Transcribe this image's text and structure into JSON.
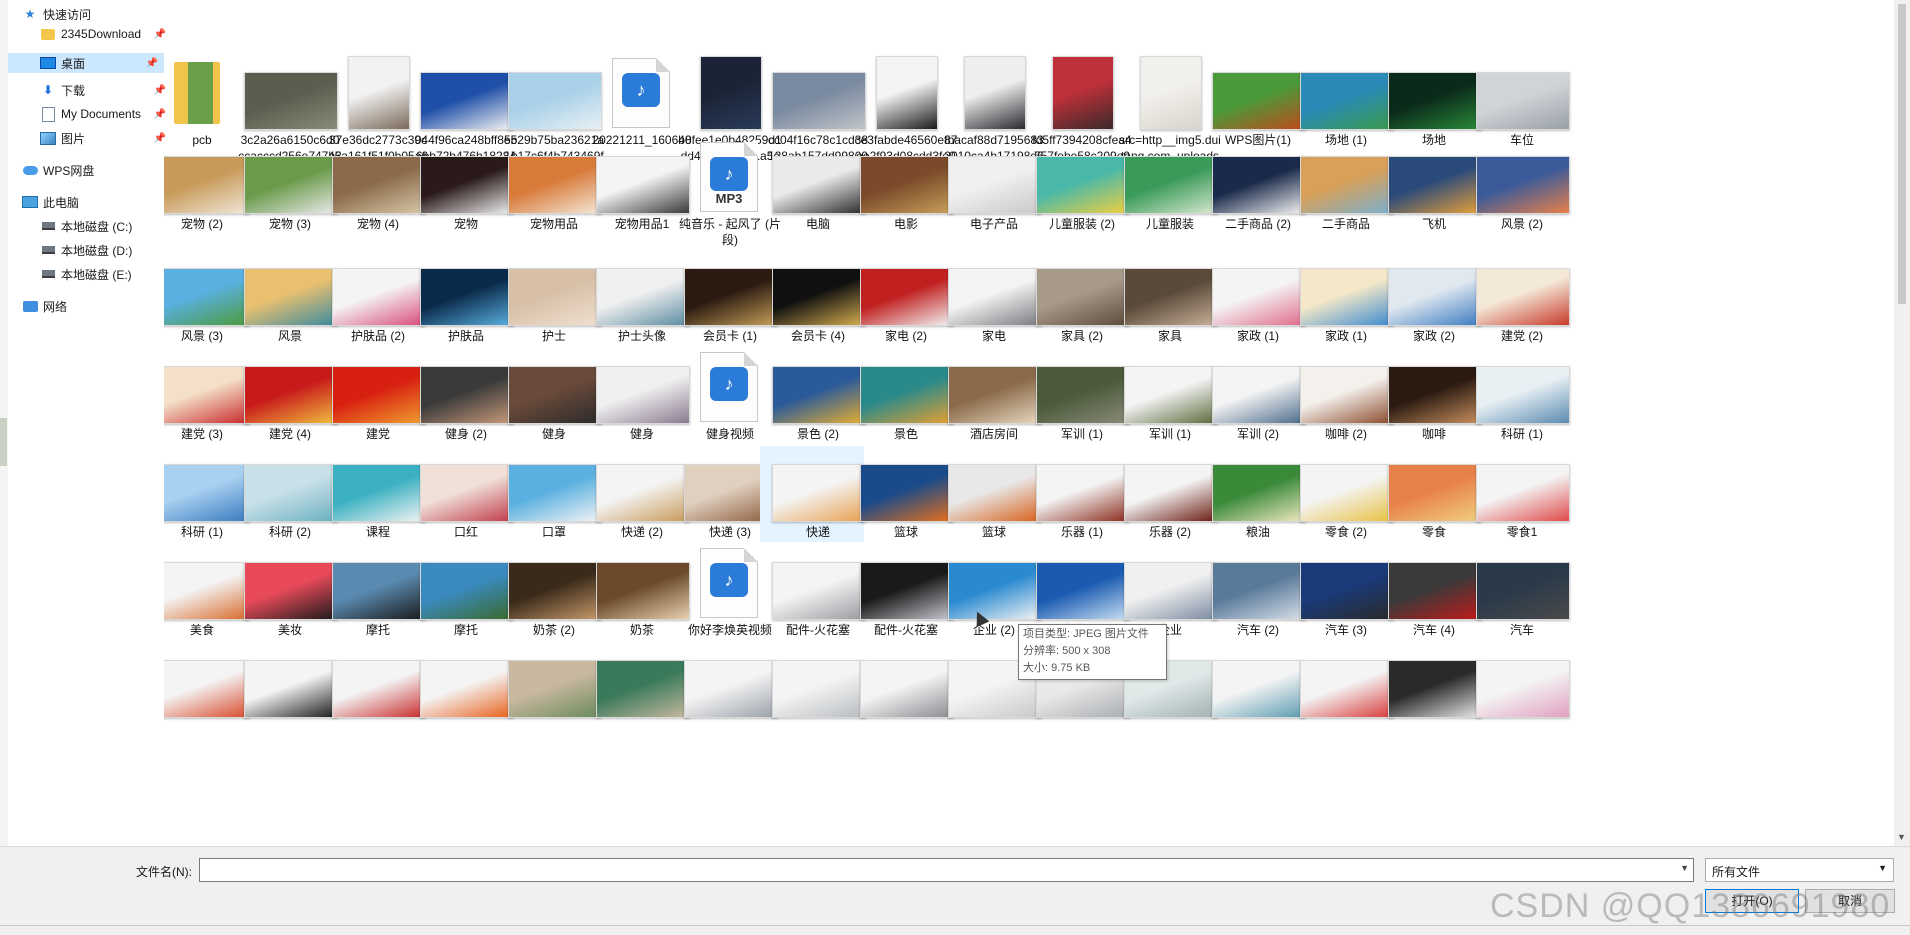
{
  "sidebar": {
    "items": [
      {
        "label": "快速访问",
        "icon": "star-icon"
      },
      {
        "label": "2345Download",
        "icon": "folder-icon",
        "pinned": true
      },
      {
        "label": "桌面",
        "icon": "desktop-icon",
        "pinned": true,
        "selected": true
      },
      {
        "label": "下载",
        "icon": "download-icon",
        "pinned": true
      },
      {
        "label": "My Documents",
        "icon": "document-icon",
        "pinned": true
      },
      {
        "label": "图片",
        "icon": "pictures-icon",
        "pinned": true
      },
      {
        "label": "WPS网盘",
        "icon": "cloud-icon"
      },
      {
        "label": "此电脑",
        "icon": "computer-icon"
      },
      {
        "label": "本地磁盘 (C:)",
        "icon": "drive-icon"
      },
      {
        "label": "本地磁盘 (D:)",
        "icon": "drive-icon"
      },
      {
        "label": "本地磁盘 (E:)",
        "icon": "drive-icon"
      },
      {
        "label": "网络",
        "icon": "network-icon"
      }
    ],
    "pin_glyph": "📌"
  },
  "files": [
    {
      "name": "pcb",
      "kind": "folder",
      "colors": [
        "#f0c44c",
        "#6aa04a"
      ]
    },
    {
      "name": "3c2a26a6150c6d0ccacccd256e747b3c",
      "kind": "image",
      "colors": [
        "#5a5e4e",
        "#8a8a78"
      ]
    },
    {
      "name": "37e36dc2773c39c45a161f51f0b05a6c",
      "kind": "image",
      "colors": [
        "#f2f2f2",
        "#7b6a5a"
      ]
    },
    {
      "name": "044f96ca248bff8eb6bb72b476b18284 (1)(1)",
      "kind": "image",
      "colors": [
        "#1f4fa8",
        "#f4f4f4"
      ]
    },
    {
      "name": "5529b75ba23621a1b17c6f4b743469f5",
      "kind": "image",
      "colors": [
        "#a8d0e8",
        "#e8f0f4"
      ]
    },
    {
      "name": "20221211_160640",
      "kind": "video"
    },
    {
      "name": "b8fee1e0b48259d1dd49a549c361a5c2",
      "kind": "image",
      "colors": [
        "#1a2436",
        "#2a3a5a"
      ]
    },
    {
      "name": "cc04f16c78c1cd38128ab157dd998093",
      "kind": "image",
      "colors": [
        "#7a8aa0",
        "#c0c4c8"
      ]
    },
    {
      "name": "ce3fabde46560e87ee2f93d08cdd3fe0(1)",
      "kind": "image",
      "colors": [
        "#f4f4f4",
        "#1a1a1a"
      ]
    },
    {
      "name": "fbacaf88d71956832010ca4b17198d62(1)",
      "kind": "image",
      "colors": [
        "#eeeeee",
        "#2a2a30"
      ]
    },
    {
      "name": "fd5ff7394208cfea4757febe58c209e9",
      "kind": "image",
      "colors": [
        "#c0303a",
        "#3a2a2a"
      ]
    },
    {
      "name": "src=http__img5.duitang.com_uploads_item_201507_14_201...",
      "kind": "image",
      "colors": [
        "#f2f0ec",
        "#d8d4cc"
      ]
    },
    {
      "name": "WPS图片(1)",
      "kind": "image",
      "colors": [
        "#4a9a3a",
        "#c04a1a"
      ]
    },
    {
      "name": "场地 (1)",
      "kind": "image",
      "colors": [
        "#2a8ab8",
        "#3a9a4a"
      ]
    },
    {
      "name": "场地",
      "kind": "image",
      "colors": [
        "#0a2a1a",
        "#2a8a3a"
      ]
    },
    {
      "name": "车位",
      "kind": "image",
      "colors": [
        "#d0d4d8",
        "#9aa0a8"
      ]
    },
    {
      "name": "宠物 (2)",
      "kind": "image",
      "colors": [
        "#c89a5a",
        "#f0e8d8"
      ]
    },
    {
      "name": "宠物 (3)",
      "kind": "image",
      "colors": [
        "#6a9a4a",
        "#eaeaea"
      ]
    },
    {
      "name": "宠物 (4)",
      "kind": "image",
      "colors": [
        "#8a6a4a",
        "#d8c8a8"
      ]
    },
    {
      "name": "宠物",
      "kind": "image",
      "colors": [
        "#2a1a1a",
        "#f0f0f0"
      ]
    },
    {
      "name": "宠物用品",
      "kind": "image",
      "colors": [
        "#d87a3a",
        "#f4e8d8"
      ]
    },
    {
      "name": "宠物用品1",
      "kind": "image",
      "colors": [
        "#f4f4f4",
        "#3a3a3a"
      ]
    },
    {
      "name": "纯音乐 - 起风了 (片段)",
      "kind": "audio",
      "badge": "MP3"
    },
    {
      "name": "电脑",
      "kind": "image",
      "colors": [
        "#eaeaea",
        "#2a2a2a"
      ]
    },
    {
      "name": "电影",
      "kind": "image",
      "colors": [
        "#7a4a2a",
        "#c8a05a"
      ]
    },
    {
      "name": "电子产品",
      "kind": "image",
      "colors": [
        "#f0f0f0",
        "#c8c8c8"
      ]
    },
    {
      "name": "儿童服装 (2)",
      "kind": "image",
      "colors": [
        "#4ab8a8",
        "#f0d040"
      ]
    },
    {
      "name": "儿童服装",
      "kind": "image",
      "colors": [
        "#3a9a5a",
        "#d8e8d0"
      ]
    },
    {
      "name": "二手商品 (2)",
      "kind": "image",
      "colors": [
        "#1a2a4a",
        "#f4f4f4"
      ]
    },
    {
      "name": "二手商品",
      "kind": "image",
      "colors": [
        "#d8a058",
        "#7ab0d0"
      ]
    },
    {
      "name": "飞机",
      "kind": "image",
      "colors": [
        "#2a4a7a",
        "#e8a03a"
      ]
    },
    {
      "name": "风景 (2)",
      "kind": "image",
      "colors": [
        "#3a5a9a",
        "#e8804a"
      ]
    },
    {
      "name": "风景 (3)",
      "kind": "image",
      "colors": [
        "#5ab0e0",
        "#4a9a3a"
      ]
    },
    {
      "name": "风景",
      "kind": "image",
      "colors": [
        "#e8c070",
        "#3a8aa0"
      ]
    },
    {
      "name": "护肤品 (2)",
      "kind": "image",
      "colors": [
        "#f4f4f4",
        "#d84a7a"
      ]
    },
    {
      "name": "护肤品",
      "kind": "image",
      "colors": [
        "#0a2a4a",
        "#5ab0e0"
      ]
    },
    {
      "name": "护士",
      "kind": "image",
      "colors": [
        "#d8c0a8",
        "#f0e0d0"
      ]
    },
    {
      "name": "护士头像",
      "kind": "image",
      "colors": [
        "#f0f0f0",
        "#5a8aa0"
      ]
    },
    {
      "name": "会员卡 (1)",
      "kind": "image",
      "colors": [
        "#2a1a10",
        "#c8a05a"
      ]
    },
    {
      "name": "会员卡 (4)",
      "kind": "image",
      "colors": [
        "#101010",
        "#d8b050"
      ]
    },
    {
      "name": "家电 (2)",
      "kind": "image",
      "colors": [
        "#c02020",
        "#f4f4f4"
      ]
    },
    {
      "name": "家电",
      "kind": "image",
      "colors": [
        "#f4f4f4",
        "#7a7a80"
      ]
    },
    {
      "name": "家具 (2)",
      "kind": "image",
      "colors": [
        "#a89a88",
        "#5a4a3a"
      ]
    },
    {
      "name": "家具",
      "kind": "image",
      "colors": [
        "#5a4a3a",
        "#c8b098"
      ]
    },
    {
      "name": "家政 (1)",
      "kind": "image",
      "colors": [
        "#f4f4f4",
        "#e06a8a"
      ]
    },
    {
      "name": "家政 (1)",
      "kind": "image",
      "colors": [
        "#f4e8c8",
        "#3a8ad0"
      ]
    },
    {
      "name": "家政 (2)",
      "kind": "image",
      "colors": [
        "#e0e8f0",
        "#3a7ac0"
      ]
    },
    {
      "name": "建党 (2)",
      "kind": "image",
      "colors": [
        "#f4e8d8",
        "#c83a2a"
      ]
    },
    {
      "name": "建党 (3)",
      "kind": "image",
      "colors": [
        "#f4e0c8",
        "#c8282a"
      ]
    },
    {
      "name": "建党 (4)",
      "kind": "image",
      "colors": [
        "#c81a1a",
        "#f0c040"
      ]
    },
    {
      "name": "建党",
      "kind": "image",
      "colors": [
        "#d82010",
        "#f0a030"
      ]
    },
    {
      "name": "健身 (2)",
      "kind": "image",
      "colors": [
        "#3a3a3a",
        "#c89a7a"
      ]
    },
    {
      "name": "健身",
      "kind": "image",
      "colors": [
        "#6a4a3a",
        "#2a2a2a"
      ]
    },
    {
      "name": "健身",
      "kind": "image",
      "colors": [
        "#f0f0f0",
        "#8a7a90"
      ]
    },
    {
      "name": "健身视频",
      "kind": "video"
    },
    {
      "name": "景色 (2)",
      "kind": "image",
      "colors": [
        "#2a5a9a",
        "#e8b030"
      ]
    },
    {
      "name": "景色",
      "kind": "image",
      "colors": [
        "#2a8a8a",
        "#e8a030"
      ]
    },
    {
      "name": "酒店房间",
      "kind": "image",
      "colors": [
        "#8a6a4a",
        "#e8d8c0"
      ]
    },
    {
      "name": "军训 (1)",
      "kind": "image",
      "colors": [
        "#4a5a3a",
        "#8a8a7a"
      ]
    },
    {
      "name": "军训 (1)",
      "kind": "image",
      "colors": [
        "#f4f4f4",
        "#5a6a3a"
      ]
    },
    {
      "name": "军训 (2)",
      "kind": "image",
      "colors": [
        "#f4f4f4",
        "#4a6a8a"
      ]
    },
    {
      "name": "咖啡 (2)",
      "kind": "image",
      "colors": [
        "#f4f0ec",
        "#8a4a2a"
      ]
    },
    {
      "name": "咖啡",
      "kind": "image",
      "colors": [
        "#2a1a10",
        "#c89060"
      ]
    },
    {
      "name": "科研 (1)",
      "kind": "image",
      "colors": [
        "#e8f0f4",
        "#5a8ab0"
      ]
    },
    {
      "name": "科研 (1)",
      "kind": "image",
      "colors": [
        "#a8d0f0",
        "#3a7ac0"
      ]
    },
    {
      "name": "科研 (2)",
      "kind": "image",
      "colors": [
        "#c8e0e8",
        "#6ab0c0"
      ]
    },
    {
      "name": "课程",
      "kind": "image",
      "colors": [
        "#3ab0c0",
        "#f4f4f4"
      ]
    },
    {
      "name": "口红",
      "kind": "image",
      "colors": [
        "#f0e0d8",
        "#c03a4a"
      ]
    },
    {
      "name": "口罩",
      "kind": "image",
      "colors": [
        "#5ab0e0",
        "#f4f4f4"
      ]
    },
    {
      "name": "快递 (2)",
      "kind": "image",
      "colors": [
        "#f4f4f4",
        "#c89a5a"
      ]
    },
    {
      "name": "快递 (3)",
      "kind": "image",
      "colors": [
        "#e0d0c0",
        "#8a5a3a"
      ]
    },
    {
      "name": "快递",
      "kind": "image",
      "colors": [
        "#f4f4f4",
        "#e8a050"
      ],
      "hover": true
    },
    {
      "name": "篮球",
      "kind": "image",
      "colors": [
        "#1a4a8a",
        "#e8701a"
      ]
    },
    {
      "name": "篮球",
      "kind": "image",
      "colors": [
        "#e8e8e8",
        "#d8601a"
      ]
    },
    {
      "name": "乐器 (1)",
      "kind": "image",
      "colors": [
        "#f4f4f4",
        "#8a2a1a"
      ]
    },
    {
      "name": "乐器 (2)",
      "kind": "image",
      "colors": [
        "#f4f4f4",
        "#6a1a10"
      ]
    },
    {
      "name": "粮油",
      "kind": "image",
      "colors": [
        "#3a8a3a",
        "#f0e8c0"
      ]
    },
    {
      "name": "零食 (2)",
      "kind": "image",
      "colors": [
        "#f4f4f4",
        "#e8c040"
      ]
    },
    {
      "name": "零食",
      "kind": "image",
      "colors": [
        "#e8804a",
        "#f0d080"
      ]
    },
    {
      "name": "零食1",
      "kind": "image",
      "colors": [
        "#f4f4f4",
        "#e04a4a"
      ]
    },
    {
      "name": "美食",
      "kind": "image",
      "colors": [
        "#f4f4f4",
        "#d86a2a"
      ]
    },
    {
      "name": "美妆",
      "kind": "image",
      "colors": [
        "#e84a5a",
        "#1a1a1a"
      ]
    },
    {
      "name": "摩托",
      "kind": "image",
      "colors": [
        "#5a8ab0",
        "#1a1a1a"
      ]
    },
    {
      "name": "摩托",
      "kind": "image",
      "colors": [
        "#3a8ac0",
        "#3a6a2a"
      ]
    },
    {
      "name": "奶茶 (2)",
      "kind": "image",
      "colors": [
        "#3a2a1a",
        "#c89a6a"
      ]
    },
    {
      "name": "奶茶",
      "kind": "image",
      "colors": [
        "#6a4a2a",
        "#e8d0b0"
      ]
    },
    {
      "name": "你好李焕英视频",
      "kind": "video"
    },
    {
      "name": "配件-火花塞",
      "kind": "image",
      "colors": [
        "#f4f4f4",
        "#9a9aa0"
      ]
    },
    {
      "name": "配件-火花塞",
      "kind": "image",
      "colors": [
        "#1a1a1a",
        "#c8c8d0"
      ]
    },
    {
      "name": "企业 (2)",
      "kind": "image",
      "colors": [
        "#2a8ad0",
        "#f4f4f4"
      ]
    },
    {
      "name": "企业 (3)",
      "kind": "image",
      "colors": [
        "#1a5ab0",
        "#c8e0f4"
      ]
    },
    {
      "name": "企业",
      "kind": "image",
      "colors": [
        "#f0f0f0",
        "#7a8aa0"
      ]
    },
    {
      "name": "汽车 (2)",
      "kind": "image",
      "colors": [
        "#5a7a9a",
        "#d8e0e8"
      ]
    },
    {
      "name": "汽车 (3)",
      "kind": "image",
      "colors": [
        "#1a3a7a",
        "#2a2a2a"
      ]
    },
    {
      "name": "汽车 (4)",
      "kind": "image",
      "colors": [
        "#3a3a3a",
        "#c01a1a"
      ]
    },
    {
      "name": "汽车",
      "kind": "image",
      "colors": [
        "#2a3a4a",
        "#4a4a4a"
      ]
    },
    {
      "name": "",
      "kind": "image",
      "colors": [
        "#f4f4f4",
        "#d84a2a"
      ]
    },
    {
      "name": "",
      "kind": "image",
      "colors": [
        "#f4f4f4",
        "#1a1a1a"
      ]
    },
    {
      "name": "",
      "kind": "image",
      "colors": [
        "#f4f4f4",
        "#c82a2a"
      ]
    },
    {
      "name": "",
      "kind": "image",
      "colors": [
        "#f4f4f4",
        "#e8601a"
      ]
    },
    {
      "name": "",
      "kind": "image",
      "colors": [
        "#c8b8a0",
        "#6a8a5a"
      ]
    },
    {
      "name": "",
      "kind": "image",
      "colors": [
        "#3a7a5a",
        "#c8b8a0"
      ]
    },
    {
      "name": "",
      "kind": "image",
      "colors": [
        "#f4f4f4",
        "#9aa0a8"
      ]
    },
    {
      "name": "",
      "kind": "image",
      "colors": [
        "#f4f4f4",
        "#b8bcc0"
      ]
    },
    {
      "name": "",
      "kind": "image",
      "colors": [
        "#f4f4f4",
        "#8a8a90"
      ]
    },
    {
      "name": "",
      "kind": "image",
      "colors": [
        "#f4f4f4",
        "#c8c8c8"
      ]
    },
    {
      "name": "",
      "kind": "image",
      "colors": [
        "#e8e8e8",
        "#a8acb0"
      ]
    },
    {
      "name": "",
      "kind": "image",
      "colors": [
        "#e0e8e8",
        "#a0b0b0"
      ]
    },
    {
      "name": "",
      "kind": "image",
      "colors": [
        "#f4f4f4",
        "#5a9ab0"
      ]
    },
    {
      "name": "",
      "kind": "image",
      "colors": [
        "#f4f4f4",
        "#d83a3a"
      ]
    },
    {
      "name": "",
      "kind": "image",
      "colors": [
        "#2a2a2a",
        "#e8e8e8"
      ]
    },
    {
      "name": "",
      "kind": "image",
      "colors": [
        "#f4f4f4",
        "#e0a0c0"
      ]
    }
  ],
  "tooltip": {
    "type_line": "项目类型: JPEG 图片文件",
    "resolution_line": "分辨率: 500 x 308",
    "size_line": "大小: 9.75 KB"
  },
  "bottom": {
    "filename_label": "文件名(N):",
    "filename_value": "",
    "filetype_value": "所有文件",
    "open_button": "打开(O)",
    "cancel_button": "取消",
    "watermark": "CSDN @QQ1386691980"
  },
  "colors": {
    "selection": "#cce8ff",
    "hover": "#e5f3ff",
    "accent": "#0078d7"
  }
}
